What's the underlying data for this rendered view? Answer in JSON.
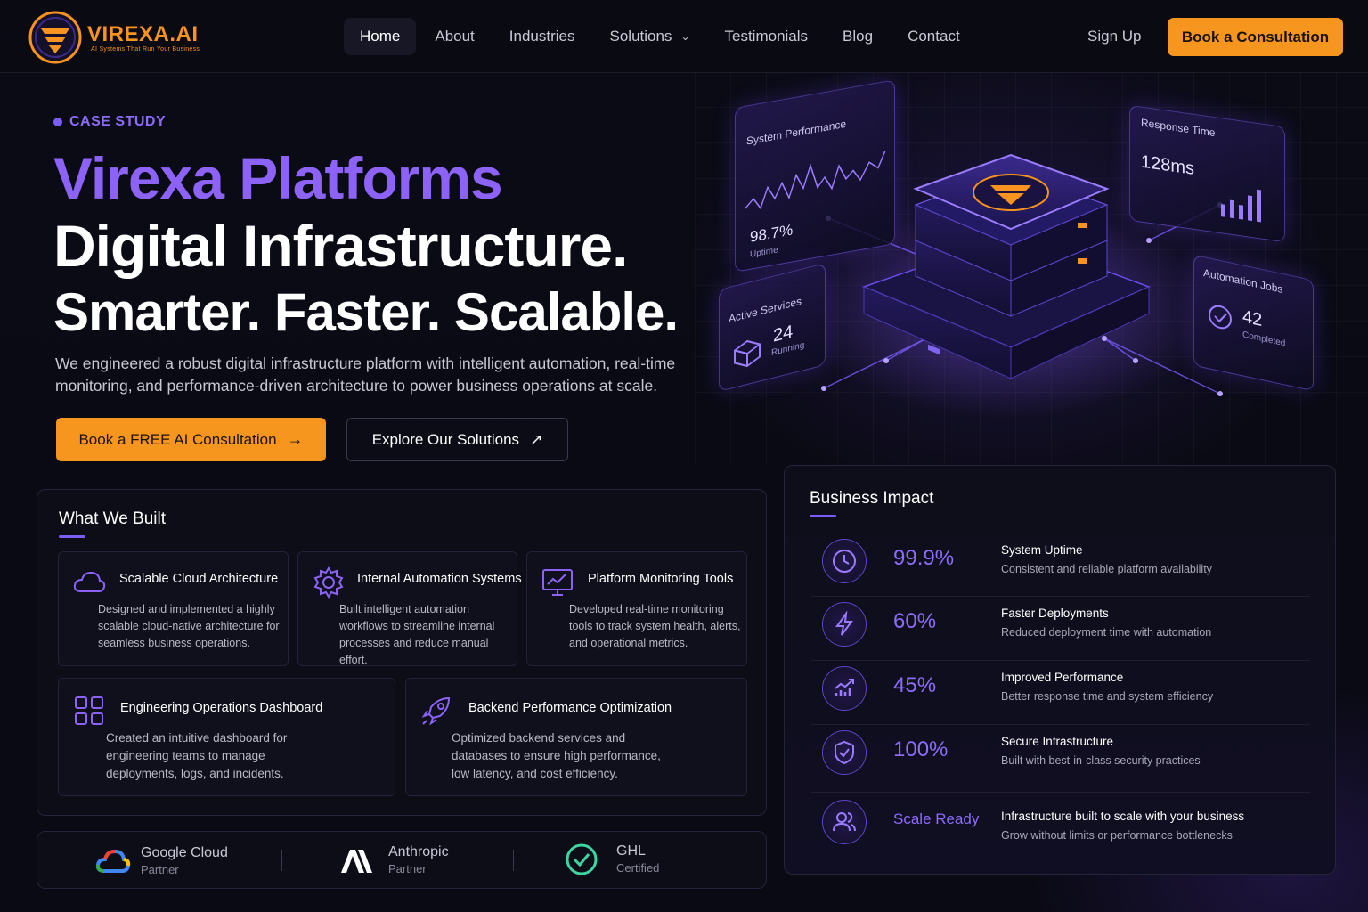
{
  "brand": {
    "name": "VIREXA.AI",
    "tagline": "AI Systems That Run Your Business",
    "accent": "#f7961f",
    "purple": "#8c62f7"
  },
  "nav": {
    "items": [
      {
        "label": "Home",
        "active": true
      },
      {
        "label": "About"
      },
      {
        "label": "Industries"
      },
      {
        "label": "Solutions",
        "dropdown": true
      },
      {
        "label": "Testimonials"
      },
      {
        "label": "Blog"
      },
      {
        "label": "Contact"
      }
    ],
    "signup": "Sign Up",
    "cta": "Book a Consultation"
  },
  "hero": {
    "eyebrow": "CASE STUDY",
    "line1": "Virexa Platforms",
    "line2": "Digital Infrastructure.",
    "line3": "Smarter. Faster. Scalable.",
    "description": "We engineered a robust digital infrastructure platform with intelligent automation, real-time monitoring, and performance-driven architecture to power business operations at scale.",
    "primary_cta": "Book a FREE AI Consultation",
    "secondary_cta": "Explore Our Solutions"
  },
  "illustration": {
    "system_performance": {
      "title": "System Performance",
      "value": "98.7%",
      "sub": "Uptime"
    },
    "response_time": {
      "title": "Response Time",
      "value": "128ms"
    },
    "active_services": {
      "title": "Active Services",
      "value": "24",
      "sub": "Running"
    },
    "automation_jobs": {
      "title": "Automation Jobs",
      "value": "42",
      "sub": "Completed"
    }
  },
  "what_we_built": {
    "title": "What We Built",
    "items": [
      {
        "title": "Scalable Cloud Architecture",
        "desc": "Designed and implemented a highly scalable cloud-native architecture for seamless business operations.",
        "icon": "cloud-icon"
      },
      {
        "title": "Internal Automation Systems",
        "desc": "Built intelligent automation workflows to streamline internal processes and reduce manual effort.",
        "icon": "gear-icon"
      },
      {
        "title": "Platform Monitoring Tools",
        "desc": "Developed real-time monitoring tools to track system health, alerts, and operational metrics.",
        "icon": "monitor-chart-icon"
      },
      {
        "title": "Engineering Operations Dashboard",
        "desc": "Created an intuitive dashboard for engineering teams to manage deployments, logs, and incidents.",
        "icon": "grid-icon"
      },
      {
        "title": "Backend Performance Optimization",
        "desc": "Optimized backend services and databases to ensure high performance, low latency, and cost efficiency.",
        "icon": "rocket-icon"
      }
    ]
  },
  "partners": [
    {
      "name": "Google Cloud",
      "sub": "Partner",
      "icon": "google-cloud-icon"
    },
    {
      "name": "Anthropic",
      "sub": "Partner",
      "icon": "anthropic-icon"
    },
    {
      "name": "GHL",
      "sub": "Certified",
      "icon": "check-circle-icon"
    }
  ],
  "business_impact": {
    "title": "Business Impact",
    "rows": [
      {
        "value": "99.9%",
        "label": "System Uptime",
        "desc": "Consistent and reliable platform availability",
        "icon": "clock-icon"
      },
      {
        "value": "60%",
        "label": "Faster Deployments",
        "desc": "Reduced deployment time with automation",
        "icon": "lightning-icon"
      },
      {
        "value": "45%",
        "label": "Improved Performance",
        "desc": "Better response time and system efficiency",
        "icon": "growth-chart-icon"
      },
      {
        "value": "100%",
        "label": "Secure Infrastructure",
        "desc": "Built with best-in-class security practices",
        "icon": "shield-check-icon"
      },
      {
        "value": "Scale Ready",
        "label": "Infrastructure built to scale with your business",
        "desc": "Grow without limits or performance bottlenecks",
        "icon": "users-icon"
      }
    ]
  }
}
